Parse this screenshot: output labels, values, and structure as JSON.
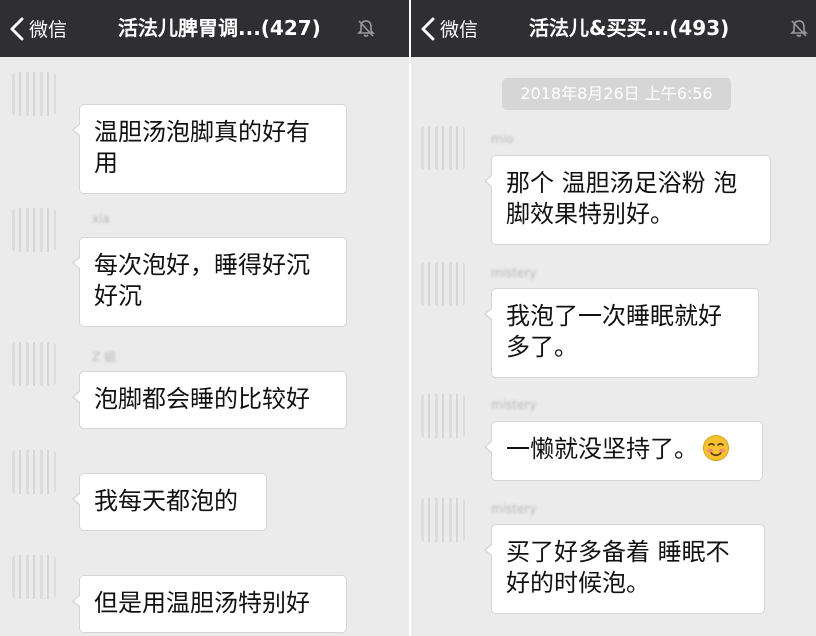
{
  "left": {
    "nav": {
      "back_label": "微信",
      "title": "活法儿脾胃调...(427)"
    },
    "messages": [
      {
        "sender": "",
        "text": "温胆汤泡脚真的好有用"
      },
      {
        "sender": "xia",
        "text": "每次泡好，睡得好沉好沉"
      },
      {
        "sender": "Z 姐",
        "text": "泡脚都会睡的比较好"
      },
      {
        "sender": "",
        "text": "我每天都泡的"
      },
      {
        "sender": "",
        "text": "但是用温胆汤特别好"
      }
    ]
  },
  "right": {
    "nav": {
      "back_label": "微信",
      "title": "活法儿&买买...(493)"
    },
    "timestamp": "2018年8月26日 上午6:56",
    "messages": [
      {
        "sender": "mio",
        "text": "那个 温胆汤足浴粉 泡脚效果特别好。"
      },
      {
        "sender": "mistery",
        "text": "我泡了一次睡眠就好多了。"
      },
      {
        "sender": "mistery",
        "text": "一懒就没坚持了。",
        "emoji": "smiling-blushing-face-icon"
      },
      {
        "sender": "mistery",
        "text": "买了好多备着 睡眠不好的时候泡。"
      }
    ]
  },
  "colors": {
    "navbar": "#2e2e33",
    "background": "#ebebeb",
    "bubble": "#ffffff",
    "timestamp_bg": "#d6d6d6"
  }
}
